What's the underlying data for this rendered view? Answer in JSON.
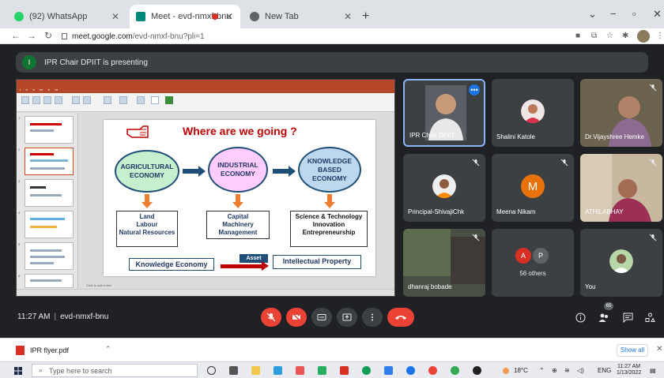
{
  "browser": {
    "tabs": [
      {
        "label": "(92) WhatsApp",
        "icon": "whatsapp-icon",
        "color": "#25d366"
      },
      {
        "label": "Meet - evd-nmxf-bnu",
        "icon": "meet-icon",
        "color": "#00897b"
      },
      {
        "label": "New Tab",
        "icon": "chrome-icon",
        "color": "#5f6368"
      }
    ],
    "new_tab": "+",
    "window_controls": {
      "minimize": "−",
      "maximize": "▫",
      "close": "✕",
      "tab_list": "⌄"
    },
    "url": {
      "host": "meet.google.com",
      "path": "/evd-nmxf-bnu?pli=1"
    }
  },
  "meet": {
    "presenting": {
      "initial": "I",
      "text": "IPR Chair DPIIT is presenting"
    },
    "slide": {
      "title": "Where are we going ?",
      "ellipses": [
        {
          "label": "AGRICULTURAL ECONOMY",
          "fill": "#c6efce"
        },
        {
          "label": "INDUSTRIAL ECONOMY",
          "fill": "#ffccff"
        },
        {
          "label": "KNOWLEDGE BASED ECONOMY",
          "fill": "#bdd7ee"
        }
      ],
      "boxes": [
        [
          "Land",
          "Labour",
          "Natural Resources"
        ],
        [
          "Capital",
          "Machinery",
          "Management"
        ],
        [
          "Science & Technology",
          "Innovation",
          "Entrepreneurship"
        ]
      ],
      "bottom_left": "Knowledge Economy",
      "asset": "Asset",
      "bottom_right": "Intellectual Property",
      "notes": "Click to add notes"
    },
    "participants": [
      {
        "name": "IPR Chair DPIIT",
        "muted": false,
        "speaker": true
      },
      {
        "name": "Shalini Katole",
        "muted": false
      },
      {
        "name": "Dr.Vijayshree Hemke",
        "muted": true
      },
      {
        "name": "Principal-ShivajiChk",
        "muted": true
      },
      {
        "name": "Meena Nikam",
        "muted": true,
        "initial": "M"
      },
      {
        "name": "ATHILABHAY",
        "muted": true
      },
      {
        "name": "dhanraj bobade",
        "muted": true
      },
      {
        "name": "56 others",
        "muted": false,
        "initials": [
          "A",
          "P"
        ]
      },
      {
        "name": "You",
        "muted": true
      }
    ],
    "time": "11:27 AM",
    "meeting_code": "evd-nmxf-bnu",
    "people_count": "65",
    "accent": "#ea4335"
  },
  "downloads": {
    "file": "IPR flyer.pdf",
    "show_all": "Show all"
  },
  "taskbar": {
    "search_placeholder": "Type here to search",
    "weather": "18°C",
    "lang": "ENG",
    "time": "11:27 AM",
    "date": "1/13/2022"
  }
}
